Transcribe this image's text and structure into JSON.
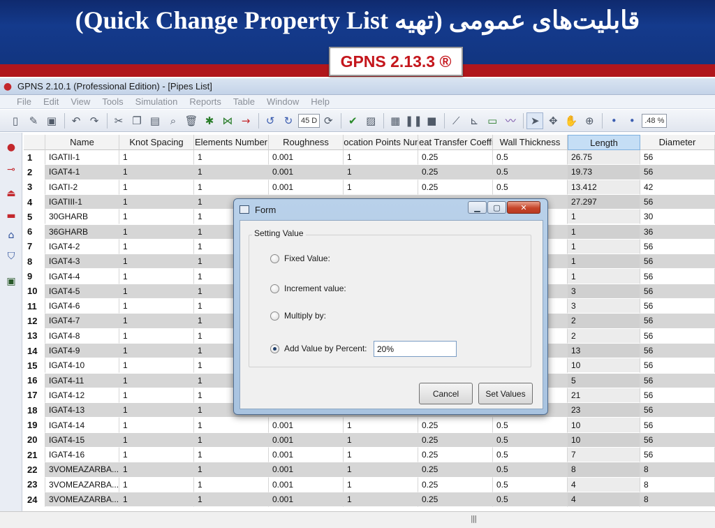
{
  "slide": {
    "title": "قابلیت‌های عمومی (تهیه Quick Change Property List)",
    "version_badge": "GPNS 2.13.3 ®"
  },
  "app": {
    "title": "GPNS 2.10.1 (Professional Edition)  - [Pipes List]",
    "menu": [
      "File",
      "Edit",
      "View",
      "Tools",
      "Simulation",
      "Reports",
      "Table",
      "Window",
      "Help"
    ],
    "toolbar": {
      "zoom_box": "45 D",
      "percent_box": ".48 %"
    }
  },
  "grid": {
    "columns": [
      "Name",
      "Knot Spacing",
      "Elements Number",
      "Roughness",
      "Location Points Num",
      "Heat Transfer Coeffic",
      "Wall Thickness",
      "Length",
      "Diameter"
    ],
    "selected_column": "Length",
    "rows": [
      {
        "n": "1",
        "name": "IGATII-1",
        "knot": "1",
        "elem": "1",
        "rough": "0.001",
        "loc": "1",
        "heat": "0.25",
        "wall": "0.5",
        "len": "26.75",
        "diam": "56"
      },
      {
        "n": "2",
        "name": "IGAT4-1",
        "knot": "1",
        "elem": "1",
        "rough": "0.001",
        "loc": "1",
        "heat": "0.25",
        "wall": "0.5",
        "len": "19.73",
        "diam": "56"
      },
      {
        "n": "3",
        "name": "IGATI-2",
        "knot": "1",
        "elem": "1",
        "rough": "0.001",
        "loc": "1",
        "heat": "0.25",
        "wall": "0.5",
        "len": "13.412",
        "diam": "42"
      },
      {
        "n": "4",
        "name": "IGATIII-1",
        "knot": "1",
        "elem": "1",
        "rough": "",
        "loc": "",
        "heat": "",
        "wall": "",
        "len": "27.297",
        "diam": "56"
      },
      {
        "n": "5",
        "name": "30GHARB",
        "knot": "1",
        "elem": "1",
        "rough": "",
        "loc": "",
        "heat": "",
        "wall": "",
        "len": "1",
        "diam": "30"
      },
      {
        "n": "6",
        "name": "36GHARB",
        "knot": "1",
        "elem": "1",
        "rough": "",
        "loc": "",
        "heat": "",
        "wall": "",
        "len": "1",
        "diam": "36"
      },
      {
        "n": "7",
        "name": "IGAT4-2",
        "knot": "1",
        "elem": "1",
        "rough": "",
        "loc": "",
        "heat": "",
        "wall": "",
        "len": "1",
        "diam": "56"
      },
      {
        "n": "8",
        "name": "IGAT4-3",
        "knot": "1",
        "elem": "1",
        "rough": "",
        "loc": "",
        "heat": "",
        "wall": "",
        "len": "1",
        "diam": "56"
      },
      {
        "n": "9",
        "name": "IGAT4-4",
        "knot": "1",
        "elem": "1",
        "rough": "",
        "loc": "",
        "heat": "",
        "wall": "",
        "len": "1",
        "diam": "56"
      },
      {
        "n": "10",
        "name": "IGAT4-5",
        "knot": "1",
        "elem": "1",
        "rough": "",
        "loc": "",
        "heat": "",
        "wall": "",
        "len": "3",
        "diam": "56"
      },
      {
        "n": "11",
        "name": "IGAT4-6",
        "knot": "1",
        "elem": "1",
        "rough": "",
        "loc": "",
        "heat": "",
        "wall": "",
        "len": "3",
        "diam": "56"
      },
      {
        "n": "12",
        "name": "IGAT4-7",
        "knot": "1",
        "elem": "1",
        "rough": "",
        "loc": "",
        "heat": "",
        "wall": "",
        "len": "2",
        "diam": "56"
      },
      {
        "n": "13",
        "name": "IGAT4-8",
        "knot": "1",
        "elem": "1",
        "rough": "",
        "loc": "",
        "heat": "",
        "wall": "",
        "len": "2",
        "diam": "56"
      },
      {
        "n": "14",
        "name": "IGAT4-9",
        "knot": "1",
        "elem": "1",
        "rough": "",
        "loc": "",
        "heat": "",
        "wall": "",
        "len": "13",
        "diam": "56"
      },
      {
        "n": "15",
        "name": "IGAT4-10",
        "knot": "1",
        "elem": "1",
        "rough": "",
        "loc": "",
        "heat": "",
        "wall": "",
        "len": "10",
        "diam": "56"
      },
      {
        "n": "16",
        "name": "IGAT4-11",
        "knot": "1",
        "elem": "1",
        "rough": "",
        "loc": "",
        "heat": "",
        "wall": "",
        "len": "5",
        "diam": "56"
      },
      {
        "n": "17",
        "name": "IGAT4-12",
        "knot": "1",
        "elem": "1",
        "rough": "",
        "loc": "",
        "heat": "",
        "wall": "",
        "len": "21",
        "diam": "56"
      },
      {
        "n": "18",
        "name": "IGAT4-13",
        "knot": "1",
        "elem": "1",
        "rough": "",
        "loc": "",
        "heat": "",
        "wall": "",
        "len": "23",
        "diam": "56"
      },
      {
        "n": "19",
        "name": "IGAT4-14",
        "knot": "1",
        "elem": "1",
        "rough": "0.001",
        "loc": "1",
        "heat": "0.25",
        "wall": "0.5",
        "len": "10",
        "diam": "56"
      },
      {
        "n": "20",
        "name": "IGAT4-15",
        "knot": "1",
        "elem": "1",
        "rough": "0.001",
        "loc": "1",
        "heat": "0.25",
        "wall": "0.5",
        "len": "10",
        "diam": "56"
      },
      {
        "n": "21",
        "name": "IGAT4-16",
        "knot": "1",
        "elem": "1",
        "rough": "0.001",
        "loc": "1",
        "heat": "0.25",
        "wall": "0.5",
        "len": "7",
        "diam": "56"
      },
      {
        "n": "22",
        "name": "3VOMEAZARBA...",
        "knot": "1",
        "elem": "1",
        "rough": "0.001",
        "loc": "1",
        "heat": "0.25",
        "wall": "0.5",
        "len": "8",
        "diam": "8"
      },
      {
        "n": "23",
        "name": "3VOMEAZARBA...",
        "knot": "1",
        "elem": "1",
        "rough": "0.001",
        "loc": "1",
        "heat": "0.25",
        "wall": "0.5",
        "len": "4",
        "diam": "8"
      },
      {
        "n": "24",
        "name": "3VOMEAZARBA...",
        "knot": "1",
        "elem": "1",
        "rough": "0.001",
        "loc": "1",
        "heat": "0.25",
        "wall": "0.5",
        "len": "4",
        "diam": "8"
      }
    ]
  },
  "dialog": {
    "title": "Form",
    "group_label": "Setting Value",
    "options": [
      {
        "label": "Fixed Value:",
        "checked": false
      },
      {
        "label": "Increment value:",
        "checked": false
      },
      {
        "label": "Multiply by:",
        "checked": false
      },
      {
        "label": "Add Value by Percent:",
        "checked": true
      }
    ],
    "percent_value": "20%",
    "cancel_label": "Cancel",
    "set_values_label": "Set Values"
  }
}
